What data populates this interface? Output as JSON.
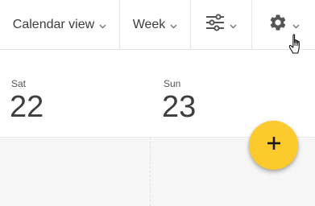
{
  "toolbar": {
    "calendar_view_label": "Calendar view",
    "range_label": "Week",
    "filter_icon": "sliders-icon",
    "settings_icon": "gear-icon"
  },
  "days": [
    {
      "name": "Sat",
      "number": "22"
    },
    {
      "name": "Sun",
      "number": "23"
    }
  ],
  "fab": {
    "icon": "plus-icon",
    "color": "#fdca2e"
  },
  "colors": {
    "accent": "#fdca2e",
    "grid_background": "#f6f6f6",
    "text": "#3e3e3e"
  }
}
